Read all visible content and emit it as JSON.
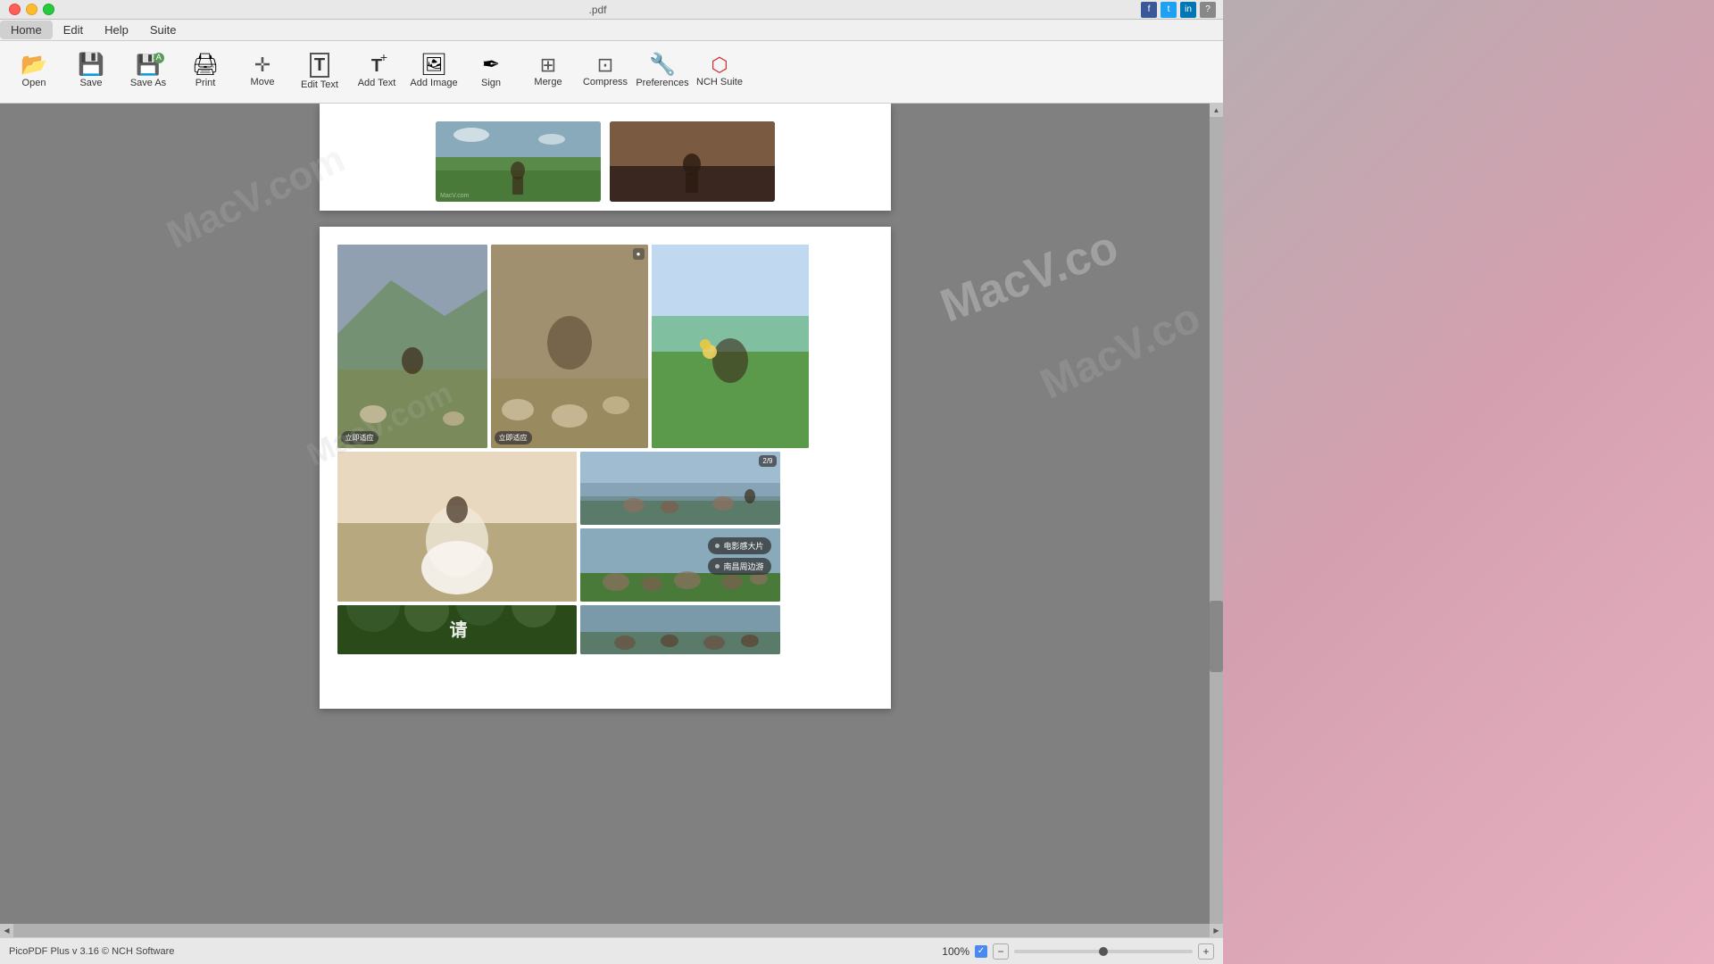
{
  "window": {
    "title": ".pdf",
    "traffic_lights": [
      "close",
      "minimize",
      "maximize"
    ]
  },
  "menu": {
    "items": [
      "Home",
      "Edit",
      "Help",
      "Suite"
    ]
  },
  "toolbar": {
    "buttons": [
      {
        "id": "open",
        "label": "Open",
        "icon": "folder"
      },
      {
        "id": "save",
        "label": "Save",
        "icon": "save"
      },
      {
        "id": "saveas",
        "label": "Save As",
        "icon": "saveas"
      },
      {
        "id": "print",
        "label": "Print",
        "icon": "print"
      },
      {
        "id": "move",
        "label": "Move",
        "icon": "move"
      },
      {
        "id": "edittext",
        "label": "Edit Text",
        "icon": "edittext"
      },
      {
        "id": "addtext",
        "label": "Add Text",
        "icon": "addtext"
      },
      {
        "id": "addimage",
        "label": "Add Image",
        "icon": "addimage"
      },
      {
        "id": "sign",
        "label": "Sign",
        "icon": "sign"
      },
      {
        "id": "merge",
        "label": "Merge",
        "icon": "merge"
      },
      {
        "id": "compress",
        "label": "Compress",
        "icon": "compress"
      },
      {
        "id": "preferences",
        "label": "Preferences",
        "icon": "prefs"
      },
      {
        "id": "nchsuite",
        "label": "NCH Suite",
        "icon": "nch"
      }
    ]
  },
  "status_bar": {
    "left_text": "PicoPDF Plus v 3.16 © NCH Software",
    "zoom_value": "100%",
    "zoom_plus_label": "+",
    "zoom_minus_label": "−"
  },
  "photos": {
    "top_page_captions": [],
    "page2": {
      "label1": "立即适应",
      "label2": "立即适应",
      "badge": "2/9",
      "bubble1": "电影感大片",
      "bubble2": "南昌周边游"
    }
  },
  "watermarks": [
    "MacV.com",
    "MacV.co",
    "MacV.com"
  ]
}
